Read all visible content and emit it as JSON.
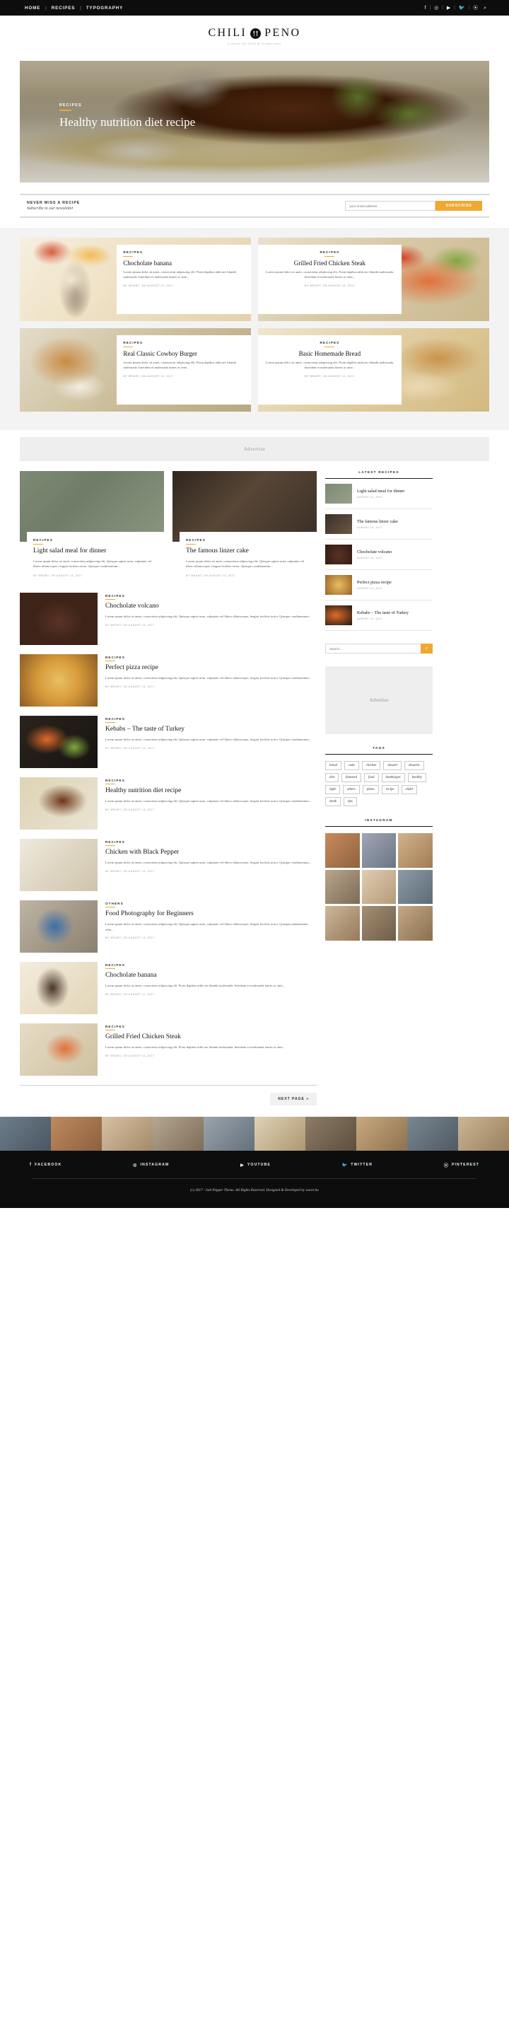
{
  "topbar": {
    "nav": [
      "HOME",
      "RECIPES",
      "TYPOGRAPHY"
    ],
    "separator": "|",
    "social": [
      "facebook-icon",
      "instagram-icon",
      "youtube-icon",
      "twitter-icon",
      "pinterest-icon",
      "search-icon"
    ]
  },
  "brand": {
    "word_left": "CHILI",
    "word_right": "PENO",
    "badge_icon": "fork-knife-icon",
    "tagline": "a theme for food & recipe sites"
  },
  "hero": {
    "category": "RECIPES",
    "title": "Healthy nutrition diet recipe"
  },
  "newsletter": {
    "title": "NEVER MISS A RECIPE",
    "subtitle": "Subscribe to our newsletter",
    "placeholder": "your email address",
    "button": "SUBSCRIBE"
  },
  "featured": [
    {
      "category": "RECIPES",
      "title": "Chocholate banana",
      "excerpt": "Lorem ipsum dolor sit amet, consectetur adipiscing elit. Proin dapibus nibh nec blandit malesuada. Interdum et malesuada fames ac ante...",
      "meta": "BY WEART, ON AUGUST 11, 2017",
      "align": "left"
    },
    {
      "category": "RECIPES",
      "title": "Grilled Fried Chicken Steak",
      "excerpt": "Lorem ipsum dolor sit amet, consectetur adipiscing elit. Proin dapibus nibh nec blandit malesuada. Interdum et malesuada fames ac ante...",
      "meta": "BY WEART, ON AUGUST 11, 2017",
      "align": "right"
    },
    {
      "category": "RECIPES",
      "title": "Real Classic Cowboy Burger",
      "excerpt": "Lorem ipsum dolor sit amet, consectetur adipiscing elit. Proin dapibus nibh nec blandit malesuada. Interdum et malesuada fames ac ante...",
      "meta": "BY WEART, ON AUGUST 11, 2017",
      "align": "left"
    },
    {
      "category": "RECIPES",
      "title": "Basic Homemade Bread",
      "excerpt": "Lorem ipsum dolor sit amet, consectetur adipiscing elit. Proin dapibus nibh nec blandit malesuada. Interdum et malesuada fames ac ante...",
      "meta": "BY WEART, ON AUGUST 11, 2017",
      "align": "right"
    }
  ],
  "advertise": {
    "label": "Advertise"
  },
  "cards": [
    {
      "category": "RECIPES",
      "title": "Light salad meal for dinner",
      "excerpt": "Lorem ipsum dolor sit amet, consectetur adipiscing elit, Quisque sapien urna, vulputate vel libero ullamcorper, feugiat facilisis tortor. Quisque condimentum...",
      "meta": "BY WEART, ON AUGUST 14, 2017"
    },
    {
      "category": "RECIPES",
      "title": "The famous linzer cake",
      "excerpt": "Lorem ipsum dolor sit amet, consectetur adipiscing elit, Quisque sapien urna, vulputate vel libero ullamcorper, feugiat facilisis tortor. Quisque condimentum...",
      "meta": "BY WEART, ON AUGUST 14, 2017"
    }
  ],
  "posts": [
    {
      "category": "RECIPES",
      "title": "Chocholate volcano",
      "excerpt": "Lorem ipsum dolor sit amet, consectetur adipiscing elit, Quisque sapien urna, vulputate vel libero ullamcorper, feugiat facilisis tortor. Quisque condimentum...",
      "meta": "BY WEART, ON AUGUST 14, 2017"
    },
    {
      "category": "RECIPES",
      "title": "Perfect pizza recipe",
      "excerpt": "Lorem ipsum dolor sit amet, consectetur adipiscing elit, Quisque sapien urna, vulputate vel libero ullamcorper, feugiat facilisis tortor. Quisque condimentum...",
      "meta": "BY WEART, ON AUGUST 14, 2017"
    },
    {
      "category": "RECIPES",
      "title": "Kebabs – The taste of Turkey",
      "excerpt": "Lorem ipsum dolor sit amet, consectetur adipiscing elit, Quisque sapien urna, vulputate vel libero ullamcorper, feugiat facilisis tortor. Quisque condimentum...",
      "meta": "BY WEART, ON AUGUST 14, 2017"
    },
    {
      "category": "RECIPES",
      "title": "Healthy nutrition diet recipe",
      "excerpt": "Lorem ipsum dolor sit amet, consectetur adipiscing elit, Quisque sapien urna, vulputate vel libero ullamcorper, feugiat facilisis tortor. Quisque condimentum...",
      "meta": "BY WEART, ON AUGUST 14, 2017"
    },
    {
      "category": "RECIPES",
      "title": "Chicken with Black Pepper",
      "excerpt": "Lorem ipsum dolor sit amet, consectetur adipiscing elit, Quisque sapien urna, vulputate vel libero ullamcorper, feugiat facilisis tortor. Quisque condimentum...",
      "meta": "BY WEART, ON AUGUST 14, 2017"
    },
    {
      "category": "OTHERS",
      "title": "Food Photography for Beginners",
      "excerpt": "Lorem ipsum dolor sit amet, consectetur adipiscing elit, Quisque sapien urna, vulputate vel libero ullamcorper, feugiat facilisis tortor. Quisquecondimentum odio...",
      "meta": "BY WEART, ON AUGUST 14, 2017"
    },
    {
      "category": "RECIPES",
      "title": "Chocholate banana",
      "excerpt": "Lorem ipsum dolor sit amet, consectetur adipiscing elit. Proin dapibus nibh nec blandit malesuada. Interdum et malesuada fames ac ante...",
      "meta": "BY WEART, ON AUGUST 11, 2017"
    },
    {
      "category": "RECIPES",
      "title": "Grilled Fried Chicken Steak",
      "excerpt": "Lorem ipsum dolor sit amet, consectetur adipiscing elit. Proin dapibus nibh nec blandit malesuada. Interdum et malesuada fames ac ante...",
      "meta": "BY WEART, ON AUGUST 11, 2017"
    }
  ],
  "pagination": {
    "next_label": "NEXT PAGE »"
  },
  "sidebar": {
    "latest": {
      "heading": "LATEST RECIPES",
      "items": [
        {
          "title": "Light salad meal for dinner",
          "date": "AUGUST 14, 2017"
        },
        {
          "title": "The famous linzer cake",
          "date": "AUGUST 14, 2017"
        },
        {
          "title": "Chocholate volcano",
          "date": "AUGUST 14, 2017"
        },
        {
          "title": "Perfect pizza recipe",
          "date": "AUGUST 14, 2017"
        },
        {
          "title": "Kebabs – The taste of Turkey",
          "date": "AUGUST 14, 2017"
        }
      ]
    },
    "search": {
      "placeholder": "Search...",
      "button_icon": "search-icon"
    },
    "advertise": {
      "label": "Advertise"
    },
    "tags": {
      "heading": "TAGS",
      "items": [
        "bread",
        "cake",
        "chicken",
        "dessert",
        "desserts",
        "diet",
        "featured",
        "food",
        "hamburger",
        "healthy",
        "light",
        "others",
        "photo",
        "recipe",
        "slider",
        "steak",
        "tips"
      ]
    },
    "instagram": {
      "heading": "INSTAGRAM"
    }
  },
  "footer": {
    "social": [
      {
        "icon": "facebook-icon",
        "glyph": "f",
        "label": "FACEBOOK"
      },
      {
        "icon": "instagram-icon",
        "glyph": "◎",
        "label": "INSTAGRAM"
      },
      {
        "icon": "youtube-icon",
        "glyph": "▶",
        "label": "YOUTUBE"
      },
      {
        "icon": "twitter-icon",
        "glyph": "🐦",
        "label": "TWITTER"
      },
      {
        "icon": "pinterest-icon",
        "glyph": "⦿",
        "label": "PINTEREST"
      }
    ],
    "copyright": "(c) 2017 - Salt Pepper Theme. All Rights Reserved. Designed & Developed by weart.hu"
  },
  "colors": {
    "accent": "#efa830",
    "dark": "#0d0d0d",
    "muted": "#b8b8b8"
  }
}
